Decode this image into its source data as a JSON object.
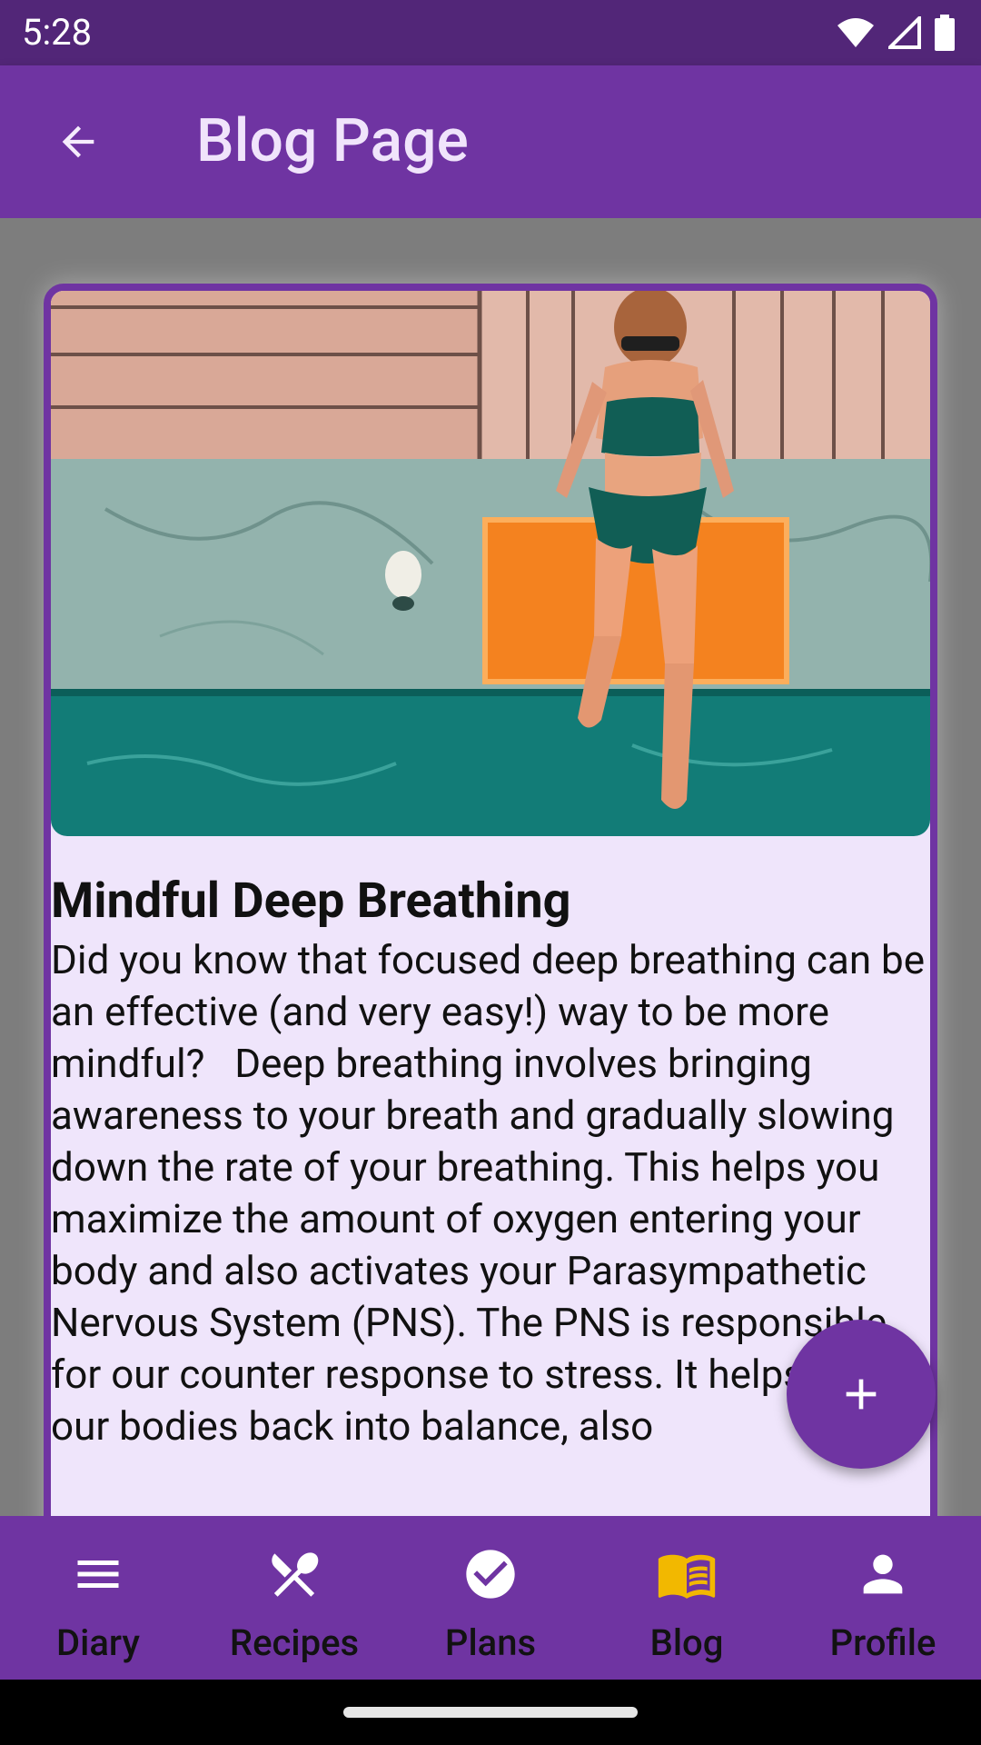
{
  "status_bar": {
    "time": "5:28",
    "icons": [
      "wifi-icon",
      "signal-icon",
      "battery-icon"
    ]
  },
  "app_bar": {
    "title": "Blog Page",
    "back_icon": "arrow-back-icon"
  },
  "post": {
    "image_alt": "woman-sitting-at-pool-edge",
    "title": "Mindful Deep Breathing",
    "body": "Did you know that focused deep breathing can be an effective (and very easy!) way to be more mindful?   Deep breathing involves bringing awareness to your breath and gradually slowing down the rate of your breathing. This helps you maximize the amount of oxygen entering your body and also activates your Parasympathetic Nervous System (PNS). The PNS is responsible for our counter response to stress. It helps bring our bodies back into balance, also"
  },
  "fab": {
    "icon": "plus-icon"
  },
  "bottom_nav": {
    "items": [
      {
        "label": "Diary",
        "icon": "menu-icon",
        "active": false
      },
      {
        "label": "Recipes",
        "icon": "utensils-icon",
        "active": false
      },
      {
        "label": "Plans",
        "icon": "check-circle-icon",
        "active": false
      },
      {
        "label": "Blog",
        "icon": "open-book-icon",
        "active": true
      },
      {
        "label": "Profile",
        "icon": "person-icon",
        "active": false
      }
    ]
  },
  "colors": {
    "primary": "#6f34a2",
    "status_bar": "#522678",
    "card_background": "#efe5fb",
    "active_nav": "#f2b800"
  }
}
